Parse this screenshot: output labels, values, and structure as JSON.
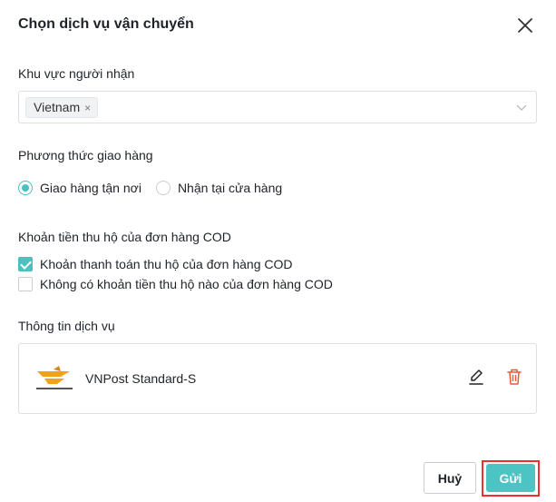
{
  "dialog": {
    "title": "Chọn dịch vụ vận chuyển"
  },
  "recipient_area": {
    "label": "Khu vực người nhận",
    "selected_tags": [
      "Vietnam"
    ],
    "remove_glyph": "×"
  },
  "delivery_method": {
    "label": "Phương thức giao hàng",
    "options": [
      {
        "label": "Giao hàng tận nơi",
        "selected": true
      },
      {
        "label": "Nhận tại cửa hàng",
        "selected": false
      }
    ]
  },
  "cod": {
    "label": "Khoản tiền thu hộ của đơn hàng COD",
    "options": [
      {
        "label": "Khoản thanh toán thu hộ của đơn hàng COD",
        "checked": true
      },
      {
        "label": "Không có khoản tiền thu hộ nào của đơn hàng COD",
        "checked": false
      }
    ]
  },
  "service_info": {
    "label": "Thông tin dịch vụ",
    "service_name": "VNPost Standard-S",
    "logo_icon": "vnpost-logo-icon",
    "edit_icon": "pencil-icon",
    "delete_icon": "trash-icon"
  },
  "footer": {
    "cancel_label": "Huỷ",
    "submit_label": "Gửi"
  },
  "colors": {
    "accent": "#4cc4c4",
    "danger": "#e8322b",
    "delete_icon": "#e8583a",
    "logo_orange": "#f0a21b"
  }
}
